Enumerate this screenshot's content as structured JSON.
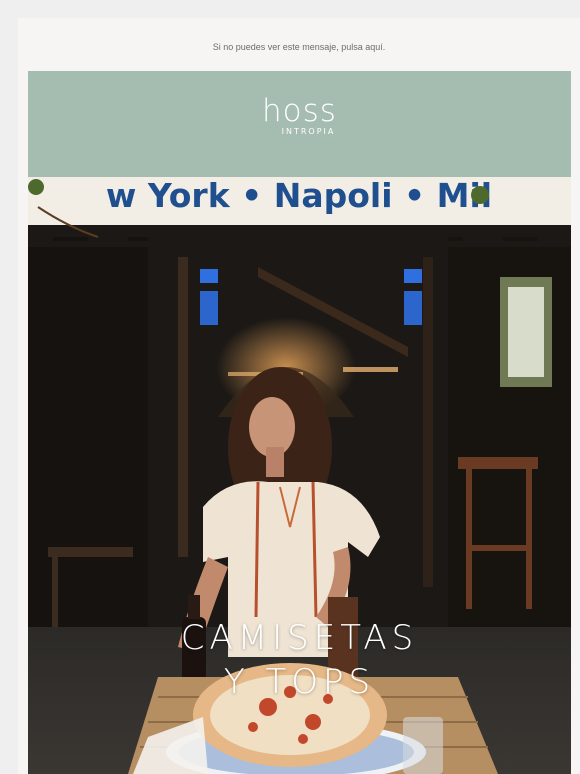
{
  "preheader": {
    "text": "Si no puedes ver este mensaje, pulsa aquí."
  },
  "logo": {
    "main": "hoss",
    "sub": "INTROPIA"
  },
  "hero": {
    "awning_text": "w York • Napoli • Mil",
    "title_line1": "CAMISETAS",
    "title_line2": "Y TOPS"
  },
  "colors": {
    "header_bg": "#a5bcb0",
    "page_bg": "#efefef",
    "card_bg": "#f6f5f3",
    "awning_text": "#1f4f8f"
  }
}
